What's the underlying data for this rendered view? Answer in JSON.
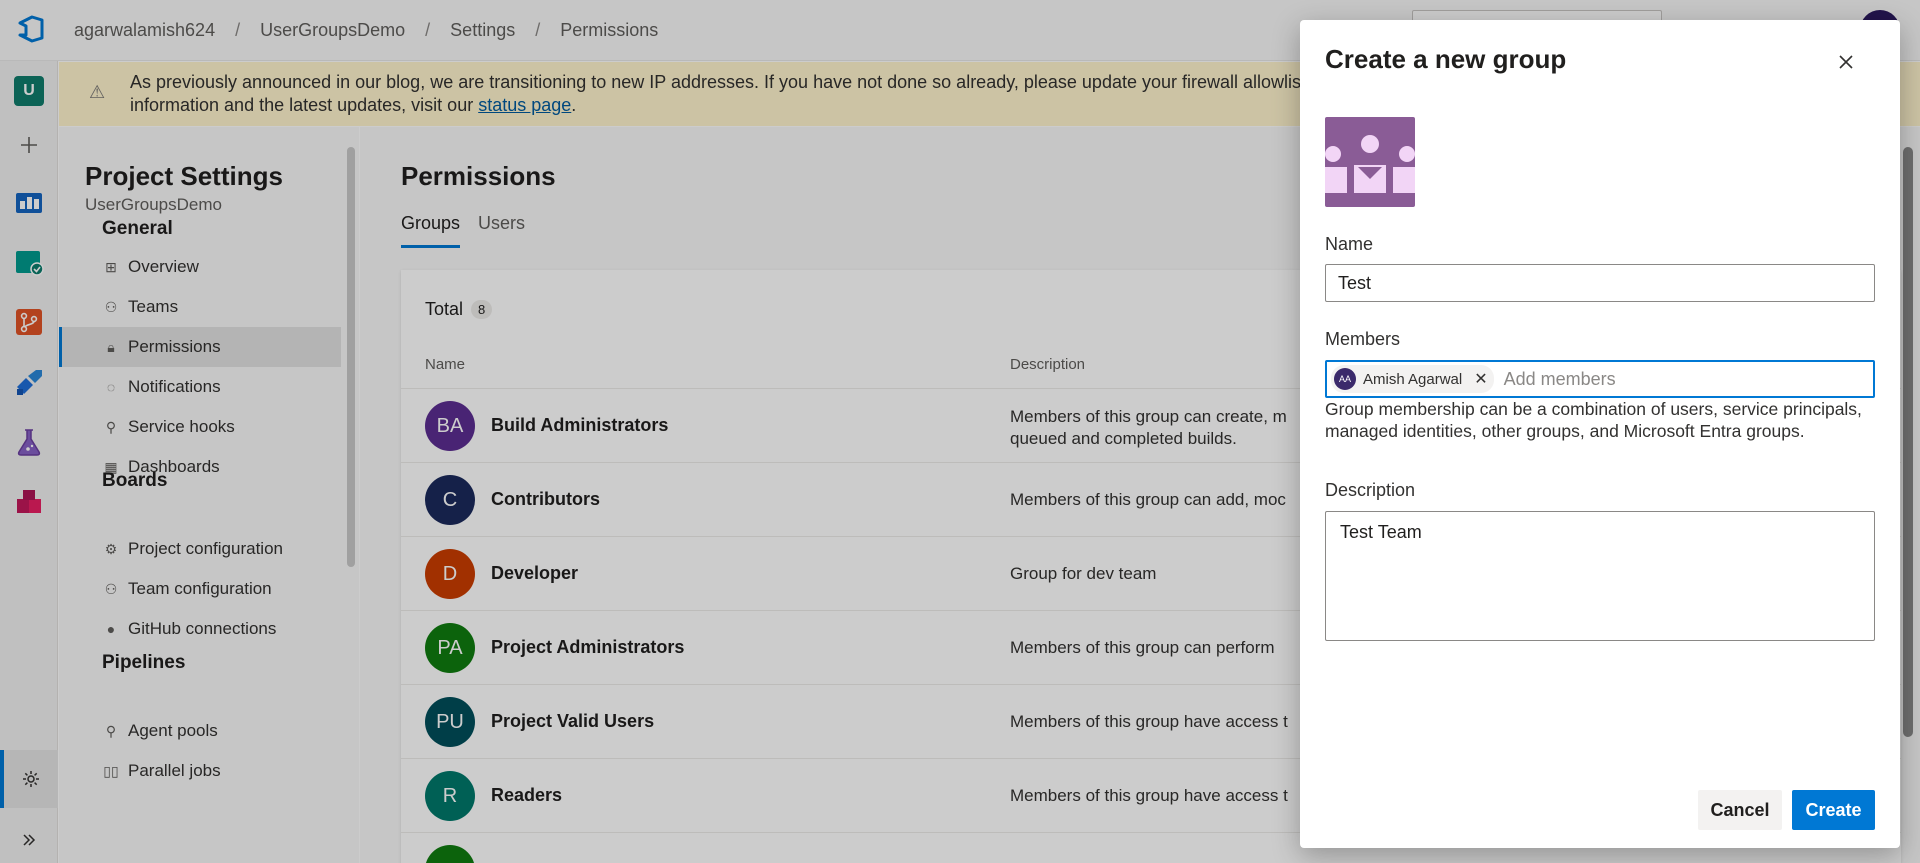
{
  "breadcrumb": [
    "agarwalamish624",
    "UserGroupsDemo",
    "Settings",
    "Permissions"
  ],
  "rail": {
    "user_initial": "U"
  },
  "banner": {
    "text": "As previously announced in our blog, we are transitioning to new IP addresses. If you have not done so already, please update your firewall allowlists wit",
    "text2_prefix": "information and the latest updates, visit our ",
    "link": "status page",
    "text2_suffix": "."
  },
  "nav": {
    "title": "Project Settings",
    "subtitle": "UserGroupsDemo",
    "general": {
      "heading": "General",
      "items": [
        "Overview",
        "Teams",
        "Permissions",
        "Notifications",
        "Service hooks",
        "Dashboards"
      ]
    },
    "boards": {
      "heading": "Boards",
      "items": [
        "Project configuration",
        "Team configuration",
        "GitHub connections"
      ]
    },
    "pipelines": {
      "heading": "Pipelines",
      "items": [
        "Agent pools",
        "Parallel jobs"
      ]
    }
  },
  "main": {
    "title": "Permissions",
    "tabs": [
      "Groups",
      "Users"
    ],
    "total_label": "Total",
    "total_count": "8",
    "columns": [
      "Name",
      "Description"
    ],
    "groups": [
      {
        "initials": "BA",
        "name": "Build Administrators",
        "description": "Members of this group can create, m",
        "description2": "queued and completed builds.",
        "color": "#5c2d91"
      },
      {
        "initials": "C",
        "name": "Contributors",
        "description": "Members of this group can add, moc",
        "color": "#1b2a5c"
      },
      {
        "initials": "D",
        "name": "Developer",
        "description": "Group for dev team",
        "color": "#ca3c00"
      },
      {
        "initials": "PA",
        "name": "Project Administrators",
        "description": "Members of this group can perform",
        "color": "#107c10"
      },
      {
        "initials": "PU",
        "name": "Project Valid Users",
        "description": "Members of this group have access t",
        "color": "#004e5a"
      },
      {
        "initials": "R",
        "name": "Readers",
        "description": "Members of this group have access t",
        "color": "#00796b"
      }
    ]
  },
  "dialog": {
    "title": "Create a new group",
    "name_label": "Name",
    "name_value": "Test",
    "members_label": "Members",
    "member_chip_initials": "AA",
    "member_chip_name": "Amish Agarwal",
    "members_placeholder": "Add members",
    "members_help": "Group membership can be a combination of users, service principals, managed identities, other groups, and Microsoft Entra groups.",
    "description_label": "Description",
    "description_value": "Test Team",
    "cancel_label": "Cancel",
    "create_label": "Create"
  },
  "colors": {
    "accent": "#0078d4",
    "banner_bg": "#fff4ce",
    "group_image_bg": "#8a5c96"
  }
}
